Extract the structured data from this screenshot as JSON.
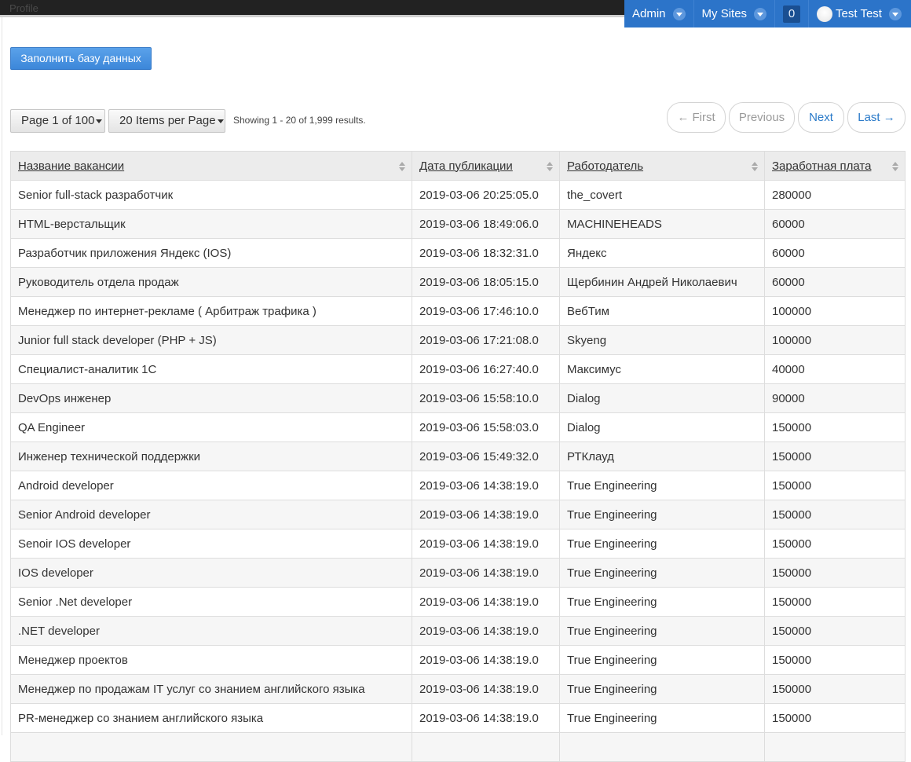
{
  "dock": {
    "brand": "Profile",
    "admin": "Admin",
    "my_sites": "My Sites",
    "count": "0",
    "user": "Test Test"
  },
  "actions": {
    "fill_db": "Заполнить базу данных"
  },
  "pager": {
    "page_select": "Page 1 of 100",
    "per_page_select": "20 Items per Page",
    "showing": "Showing 1 - 20 of 1,999 results.",
    "first": "← First",
    "previous": "Previous",
    "next": "Next",
    "last": "Last →"
  },
  "table": {
    "headers": [
      "Название вакансии",
      "Дата публикации",
      "Работодатель",
      "Заработная плата"
    ],
    "rows": [
      [
        "Senior full-stack разработчик",
        "2019-03-06 20:25:05.0",
        "the_covert",
        "280000"
      ],
      [
        "HTML-верстальщик",
        "2019-03-06 18:49:06.0",
        "MACHINEHEADS",
        "60000"
      ],
      [
        "Разработчик приложения Яндекс (IOS)",
        "2019-03-06 18:32:31.0",
        "Яндекс",
        "60000"
      ],
      [
        "Руководитель отдела продаж",
        "2019-03-06 18:05:15.0",
        "Щербинин Андрей Николаевич",
        "60000"
      ],
      [
        "Менеджер по интернет-рекламе ( Арбитраж трафика )",
        "2019-03-06 17:46:10.0",
        "ВебТим",
        "100000"
      ],
      [
        "Junior full stack developer (PHP + JS)",
        "2019-03-06 17:21:08.0",
        "Skyeng",
        "100000"
      ],
      [
        "Специалист-аналитик 1С",
        "2019-03-06 16:27:40.0",
        "Максимус",
        "40000"
      ],
      [
        "DevOps инженер",
        "2019-03-06 15:58:10.0",
        "Dialog",
        "90000"
      ],
      [
        "QA Engineer",
        "2019-03-06 15:58:03.0",
        "Dialog",
        "150000"
      ],
      [
        "Инженер технической поддержки",
        "2019-03-06 15:49:32.0",
        "РТКлауд",
        "150000"
      ],
      [
        "Android developer",
        "2019-03-06 14:38:19.0",
        "True Engineering",
        "150000"
      ],
      [
        "Senior Android developer",
        "2019-03-06 14:38:19.0",
        "True Engineering",
        "150000"
      ],
      [
        "Senoir IOS developer",
        "2019-03-06 14:38:19.0",
        "True Engineering",
        "150000"
      ],
      [
        "IOS developer",
        "2019-03-06 14:38:19.0",
        "True Engineering",
        "150000"
      ],
      [
        "Senior .Net developer",
        "2019-03-06 14:38:19.0",
        "True Engineering",
        "150000"
      ],
      [
        ".NET developer",
        "2019-03-06 14:38:19.0",
        "True Engineering",
        "150000"
      ],
      [
        "Менеджер проектов",
        "2019-03-06 14:38:19.0",
        "True Engineering",
        "150000"
      ],
      [
        "Менеджер по продажам IT услуг со знанием английского языка",
        "2019-03-06 14:38:19.0",
        "True Engineering",
        "150000"
      ],
      [
        "PR-менеджер со знанием английского языка",
        "2019-03-06 14:38:19.0",
        "True Engineering",
        "150000"
      ],
      [
        "",
        "",
        "",
        ""
      ]
    ]
  }
}
